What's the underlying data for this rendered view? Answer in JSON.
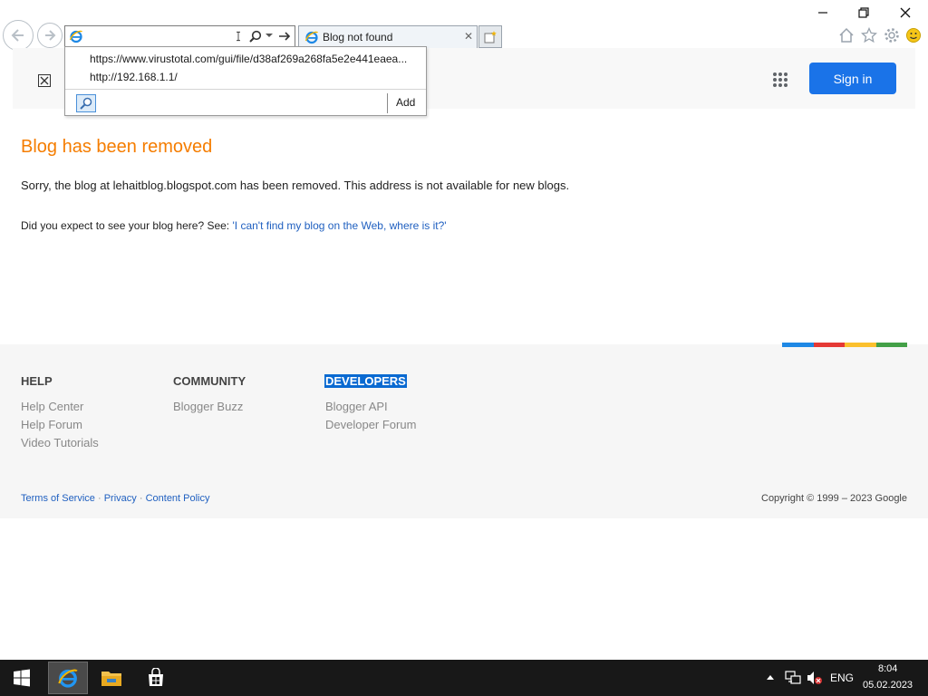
{
  "browser": {
    "tab_title": "Blog not found",
    "tab_close_glyph": "✕",
    "address_value": "",
    "dropdown": {
      "items": [
        "https://www.virustotal.com/gui/file/d38af269a268fa5e2e441eaea...",
        "http://192.168.1.1/"
      ],
      "add_label": "Add"
    },
    "icons": [
      "back-arrow-icon",
      "forward-arrow-icon",
      "ie-logo-icon",
      "search-icon",
      "go-arrow-icon",
      "new-tab-icon",
      "home-icon",
      "star-icon",
      "gear-icon",
      "smiley-icon"
    ],
    "window_controls": [
      "minimize",
      "restore",
      "close"
    ]
  },
  "blogger_header": {
    "signin_label": "Sign in",
    "signin_color": "#1a73e8"
  },
  "content": {
    "title": "Blog has been removed",
    "title_color": "#f57d00",
    "message": "Sorry, the blog at lehaitblog.blogspot.com has been removed. This address is not available for new blogs.",
    "expect_prefix": "Did you expect to see your blog here? See: ",
    "expect_link": "'I can't find my blog on the Web, where is it?'"
  },
  "footer": {
    "columns": [
      {
        "title": "HELP",
        "links": [
          "Help Center",
          "Help Forum",
          "Video Tutorials"
        ]
      },
      {
        "title": "COMMUNITY",
        "links": [
          "Blogger Buzz"
        ]
      },
      {
        "title": "DEVELOPERS",
        "links": [
          "Blogger API",
          "Developer Forum"
        ]
      }
    ],
    "legal": {
      "terms": "Terms of Service",
      "privacy": "Privacy",
      "content_policy": "Content Policy",
      "separator": "·"
    },
    "copyright": "Copyright © 1999 – 2023 Google",
    "color_bar": [
      "#1e88e5",
      "#e53935",
      "#fbc02d",
      "#43a047"
    ]
  },
  "taskbar": {
    "lang": "ENG",
    "time": "8:04",
    "date": "05.02.2023"
  }
}
